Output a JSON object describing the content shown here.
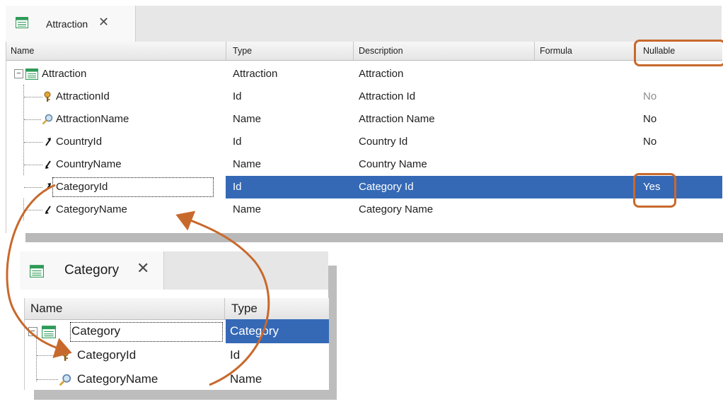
{
  "attraction_window": {
    "tab_title": "Attraction",
    "close_glyph": "✕",
    "columns": [
      "Name",
      "Type",
      "Description",
      "Formula",
      "Nullable"
    ],
    "rows": [
      {
        "name": "Attraction",
        "type": "Attraction",
        "description": "Attraction",
        "formula": "",
        "nullable": "",
        "icon": "transaction-icon"
      },
      {
        "name": "AttractionId",
        "type": "Id",
        "description": "Attraction Id",
        "formula": "",
        "nullable": "No",
        "icon": "key-icon"
      },
      {
        "name": "AttractionName",
        "type": "Name",
        "description": "Attraction Name",
        "formula": "",
        "nullable": "No",
        "icon": "search-icon"
      },
      {
        "name": "CountryId",
        "type": "Id",
        "description": "Country Id",
        "formula": "",
        "nullable": "No",
        "icon": "foreign-key-up-icon"
      },
      {
        "name": "CountryName",
        "type": "Name",
        "description": "Country Name",
        "formula": "",
        "nullable": "",
        "icon": "inferred-down-icon"
      },
      {
        "name": "CategoryId",
        "type": "Id",
        "description": "Category Id",
        "formula": "",
        "nullable": "Yes",
        "icon": "foreign-key-up-icon",
        "selected": true
      },
      {
        "name": "CategoryName",
        "type": "Name",
        "description": "Category Name",
        "formula": "",
        "nullable": "",
        "icon": "inferred-down-icon"
      }
    ]
  },
  "category_window": {
    "tab_title": "Category",
    "close_glyph": "✕",
    "columns": [
      "Name",
      "Type"
    ],
    "rows": [
      {
        "name": "Category",
        "type": "Category",
        "icon": "transaction-icon",
        "selected": true
      },
      {
        "name": "CategoryId",
        "type": "Id",
        "icon": "key-icon"
      },
      {
        "name": "CategoryName",
        "type": "Name",
        "icon": "search-icon"
      }
    ]
  },
  "colors": {
    "selection": "#3569b6",
    "annotation": "#c8692c",
    "icon_green": "#2e9b57"
  }
}
